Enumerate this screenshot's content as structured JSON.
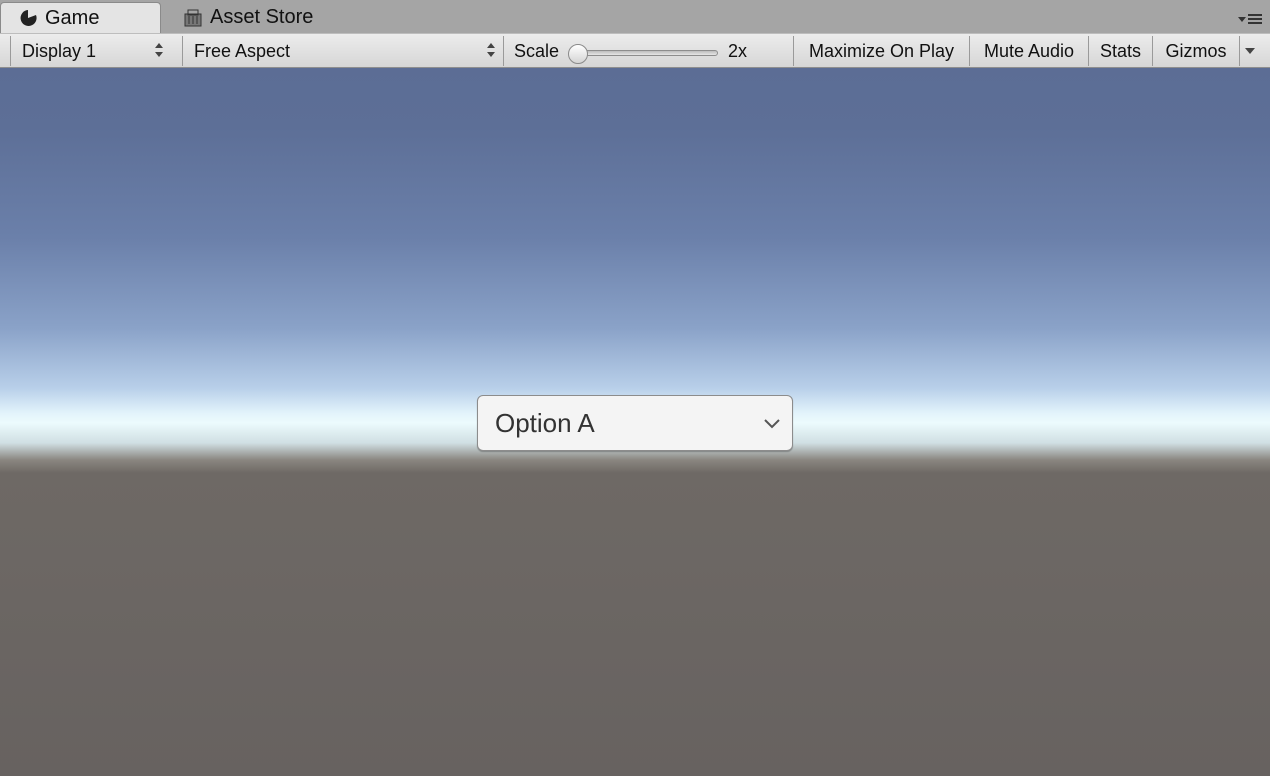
{
  "tabs": [
    {
      "label": "Game",
      "icon": "pacman-icon",
      "active": true
    },
    {
      "label": "Asset Store",
      "icon": "store-bag-icon",
      "active": false
    }
  ],
  "toolbar": {
    "display": "Display 1",
    "aspect": "Free Aspect",
    "scale_label": "Scale",
    "scale_value": "2x",
    "scale_slider_position": 0.0,
    "maximize_on_play": "Maximize On Play",
    "mute_audio": "Mute Audio",
    "stats": "Stats",
    "gizmos": "Gizmos"
  },
  "game": {
    "dropdown_value": "Option A"
  },
  "colors": {
    "sky_top": "#5c6d95",
    "horizon": "#ecfbfd",
    "ground": "#676260"
  }
}
